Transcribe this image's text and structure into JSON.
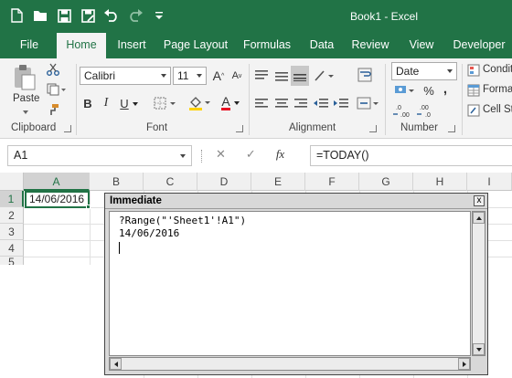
{
  "colors": {
    "brand": "#217346",
    "ribbon": "#f3f3f3",
    "active_tab_text": "#217346"
  },
  "window": {
    "title": "Book1 - Excel"
  },
  "quick_access": {
    "icons": [
      "new-document-icon",
      "open-folder-icon",
      "save-icon",
      "save-as-icon",
      "undo-icon",
      "redo-icon",
      "customize-qat-icon"
    ]
  },
  "tabs": [
    {
      "label": "File"
    },
    {
      "label": "Home",
      "active": true
    },
    {
      "label": "Insert"
    },
    {
      "label": "Page Layout"
    },
    {
      "label": "Formulas"
    },
    {
      "label": "Data"
    },
    {
      "label": "Review"
    },
    {
      "label": "View"
    },
    {
      "label": "Developer"
    }
  ],
  "ribbon": {
    "clipboard": {
      "label": "Clipboard",
      "paste_label": "Paste"
    },
    "font": {
      "label": "Font",
      "font_name": "Calibri",
      "font_size": "11",
      "bold": "B",
      "italic": "I",
      "underline": "U",
      "grow": "A",
      "shrink": "A",
      "font_color_letter": "A"
    },
    "alignment": {
      "label": "Alignment"
    },
    "number": {
      "label": "Number",
      "format": "Date",
      "percent": "%",
      "comma": ",",
      "currency": "$",
      "inc_decimal": "←.0 .00",
      "dec_decimal": ".00 →.0"
    },
    "styles": {
      "conditional": "Condit",
      "format_as_table": "Forma",
      "cell_styles": "Cell St"
    }
  },
  "formula_bar": {
    "name_box": "A1",
    "cancel": "✕",
    "enter": "✓",
    "fx": "fx",
    "formula": "=TODAY()"
  },
  "grid": {
    "columns": [
      "A",
      "B",
      "C",
      "D",
      "E",
      "F",
      "G",
      "H",
      "I"
    ],
    "rows": [
      "1",
      "2",
      "3",
      "4",
      "5"
    ],
    "cells": {
      "A1": "14/06/2016"
    }
  },
  "immediate": {
    "title": "Immediate",
    "close": "x",
    "lines": [
      "?Range(\"'Sheet1'!A1\")",
      "14/06/2016"
    ]
  }
}
